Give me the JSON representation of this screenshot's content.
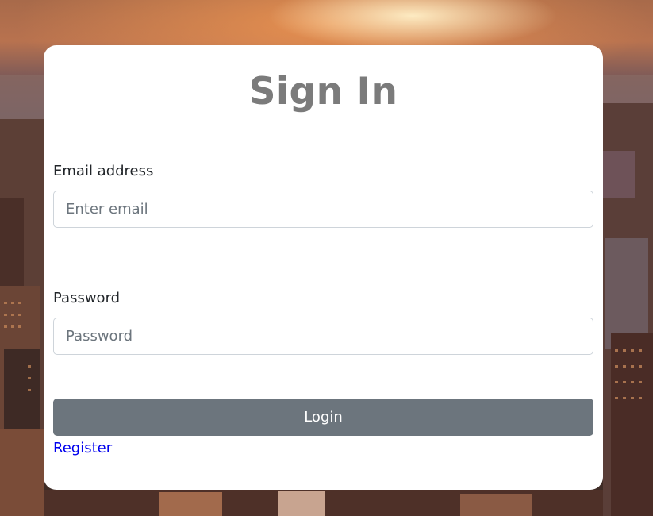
{
  "form": {
    "title": "Sign In",
    "email_label": "Email address",
    "email_placeholder": "Enter email",
    "email_value": "",
    "password_label": "Password",
    "password_placeholder": "Password",
    "password_value": "",
    "login_label": "Login",
    "register_label": "Register"
  },
  "colors": {
    "title": "#7b7b7b",
    "button": "#6c757d",
    "link": "#0000ee",
    "card": "#ffffff"
  }
}
